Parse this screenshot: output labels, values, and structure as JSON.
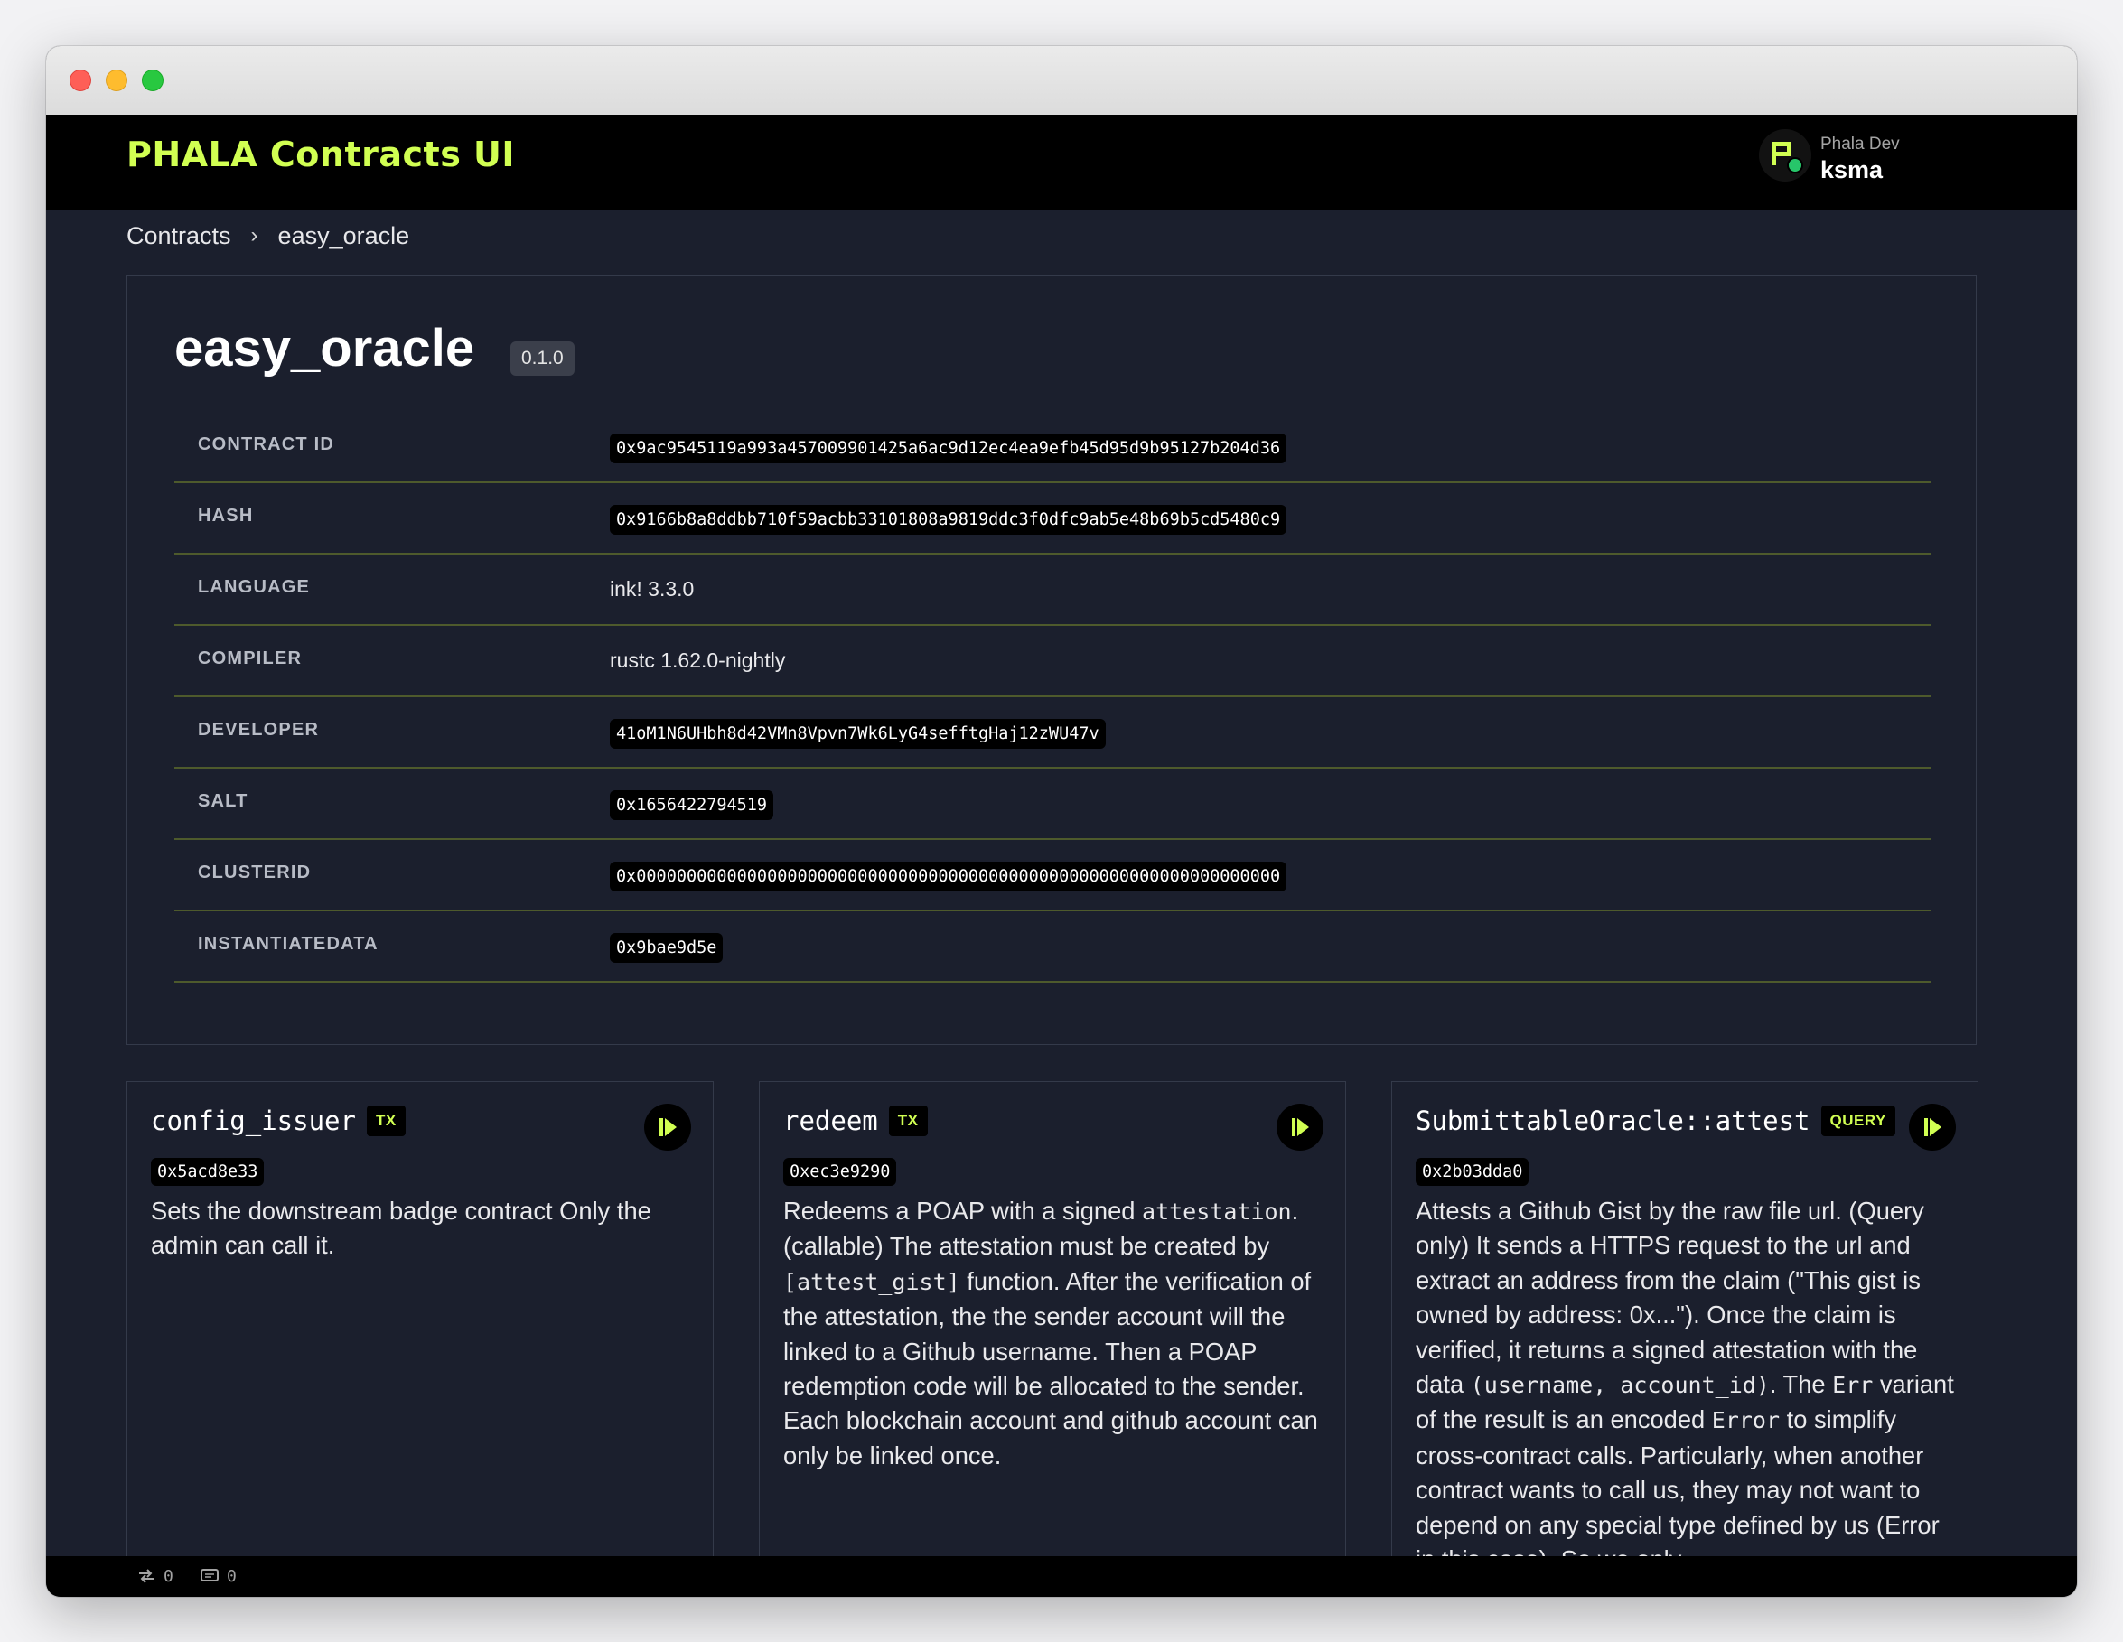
{
  "app": {
    "title": "PHALA Contracts UI"
  },
  "account": {
    "network_label": "Phala Dev",
    "name": "ksma"
  },
  "breadcrumb": {
    "root": "Contracts",
    "separator": "›",
    "current": "easy_oracle"
  },
  "contract": {
    "name": "easy_oracle",
    "version": "0.1.0",
    "fields": [
      {
        "label": "CONTRACT ID",
        "value": "0x9ac9545119a993a457009901425a6ac9d12ec4ea9efb45d95d9b95127b204d36",
        "style": "code"
      },
      {
        "label": "HASH",
        "value": "0x9166b8a8ddbb710f59acbb33101808a9819ddc3f0dfc9ab5e48b69b5cd5480c9",
        "style": "code"
      },
      {
        "label": "LANGUAGE",
        "value": "ink! 3.3.0",
        "style": "text"
      },
      {
        "label": "COMPILER",
        "value": "rustc 1.62.0-nightly",
        "style": "text"
      },
      {
        "label": "DEVELOPER",
        "value": "41oM1N6UHbh8d42VMn8Vpvn7Wk6LyG4sefftgHaj12zWU47v",
        "style": "code"
      },
      {
        "label": "SALT",
        "value": "0x1656422794519",
        "style": "code"
      },
      {
        "label": "CLUSTERID",
        "value": "0x0000000000000000000000000000000000000000000000000000000000000000",
        "style": "code"
      },
      {
        "label": "INSTANTIATEDATA",
        "value": "0x9bae9d5e",
        "style": "code"
      }
    ]
  },
  "methods": [
    {
      "name": "config_issuer",
      "kind": "TX",
      "selector": "0x5acd8e33",
      "description": [
        {
          "t": "Sets the downstream badge contract Only the admin can call it."
        }
      ]
    },
    {
      "name": "redeem",
      "kind": "TX",
      "selector": "0xec3e9290",
      "description": [
        {
          "t": "Redeems a POAP with a signed "
        },
        {
          "c": "attestation"
        },
        {
          "t": ". (callable) The attestation must be created by "
        },
        {
          "c": "[attest_gist]"
        },
        {
          "t": " function. After the verification of the attestation, the the sender account will the linked to a Github username. Then a POAP redemption code will be allocated to the sender. Each blockchain account and github account can only be linked once."
        }
      ]
    },
    {
      "name": "SubmittableOracle::attest",
      "kind": "QUERY",
      "selector": "0x2b03dda0",
      "description": [
        {
          "t": "Attests a Github Gist by the raw file url. (Query only) It sends a HTTPS request to the url and extract an address from the claim (\"This gist is owned by address: 0x...\"). Once the claim is verified, it returns a signed attestation with the data "
        },
        {
          "c": "(username, account_id)"
        },
        {
          "t": ". The "
        },
        {
          "c": "Err"
        },
        {
          "t": " variant of the result is an encoded "
        },
        {
          "c": "Error"
        },
        {
          "t": " to simplify cross-contract calls. Particularly, when another contract wants to call us, they may not want to depend on any special type defined by us (Error in this case). So we only"
        }
      ]
    }
  ],
  "statusbar": {
    "tx_count": "0",
    "message_count": "0"
  },
  "colors": {
    "accent": "#d1ff52",
    "background": "#1b1f2d",
    "topbar": "#000000",
    "divider": "#4e5a2c"
  },
  "icons": {
    "run": "play-icon",
    "tx_status": "transfer-icon",
    "messages": "message-icon"
  }
}
